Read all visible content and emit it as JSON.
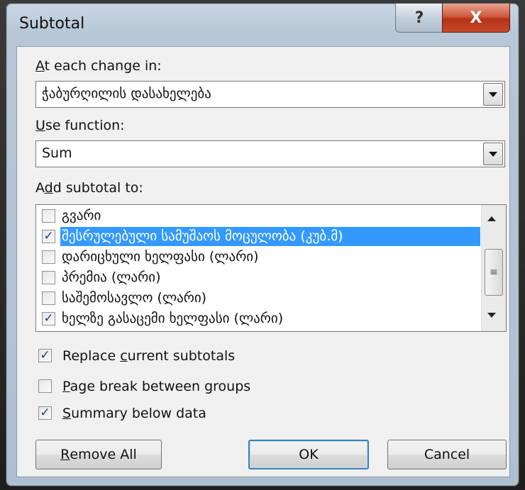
{
  "window": {
    "title": "Subtotal",
    "help_label": "?",
    "close_label": "X"
  },
  "at_each_change": {
    "label_pre": "",
    "label_ul": "A",
    "label_post": "t each change in:",
    "value": "ჭაბურღილის დასახელება"
  },
  "use_function": {
    "label_ul": "U",
    "label_post": "se function:",
    "value": "Sum"
  },
  "add_subtotal": {
    "label_pre": "A",
    "label_ul": "d",
    "label_post": "d subtotal to:",
    "items": [
      {
        "label": "გვარი",
        "checked": false,
        "selected": false
      },
      {
        "label": "შესრულებული სამუშაოს მოცულობა     (კუბ.მ)",
        "checked": true,
        "selected": true
      },
      {
        "label": "დარიცხული ხელფასი (ლარი)",
        "checked": false,
        "selected": false
      },
      {
        "label": "პრემია (ლარი)",
        "checked": false,
        "selected": false
      },
      {
        "label": "საშემოსავლო (ლარი)",
        "checked": false,
        "selected": false
      },
      {
        "label": "ხელზე გასაცემი ხელფასი (ლარი)",
        "checked": true,
        "selected": false
      }
    ]
  },
  "options": {
    "replace": {
      "pre": "Replace ",
      "ul": "c",
      "post": "urrent subtotals",
      "checked": true
    },
    "page_break": {
      "pre": "",
      "ul": "P",
      "post": "age break between groups",
      "checked": false
    },
    "summary": {
      "pre": "",
      "ul": "S",
      "post": "ummary below data",
      "checked": true
    }
  },
  "buttons": {
    "remove_all_ul": "R",
    "remove_all_post": "emove All",
    "ok": "OK",
    "cancel": "Cancel"
  },
  "check_glyph": "✓",
  "icons": {
    "dropdown": "chevron-down-icon",
    "scroll_up": "scroll-up-icon",
    "scroll_down": "scroll-down-icon"
  }
}
